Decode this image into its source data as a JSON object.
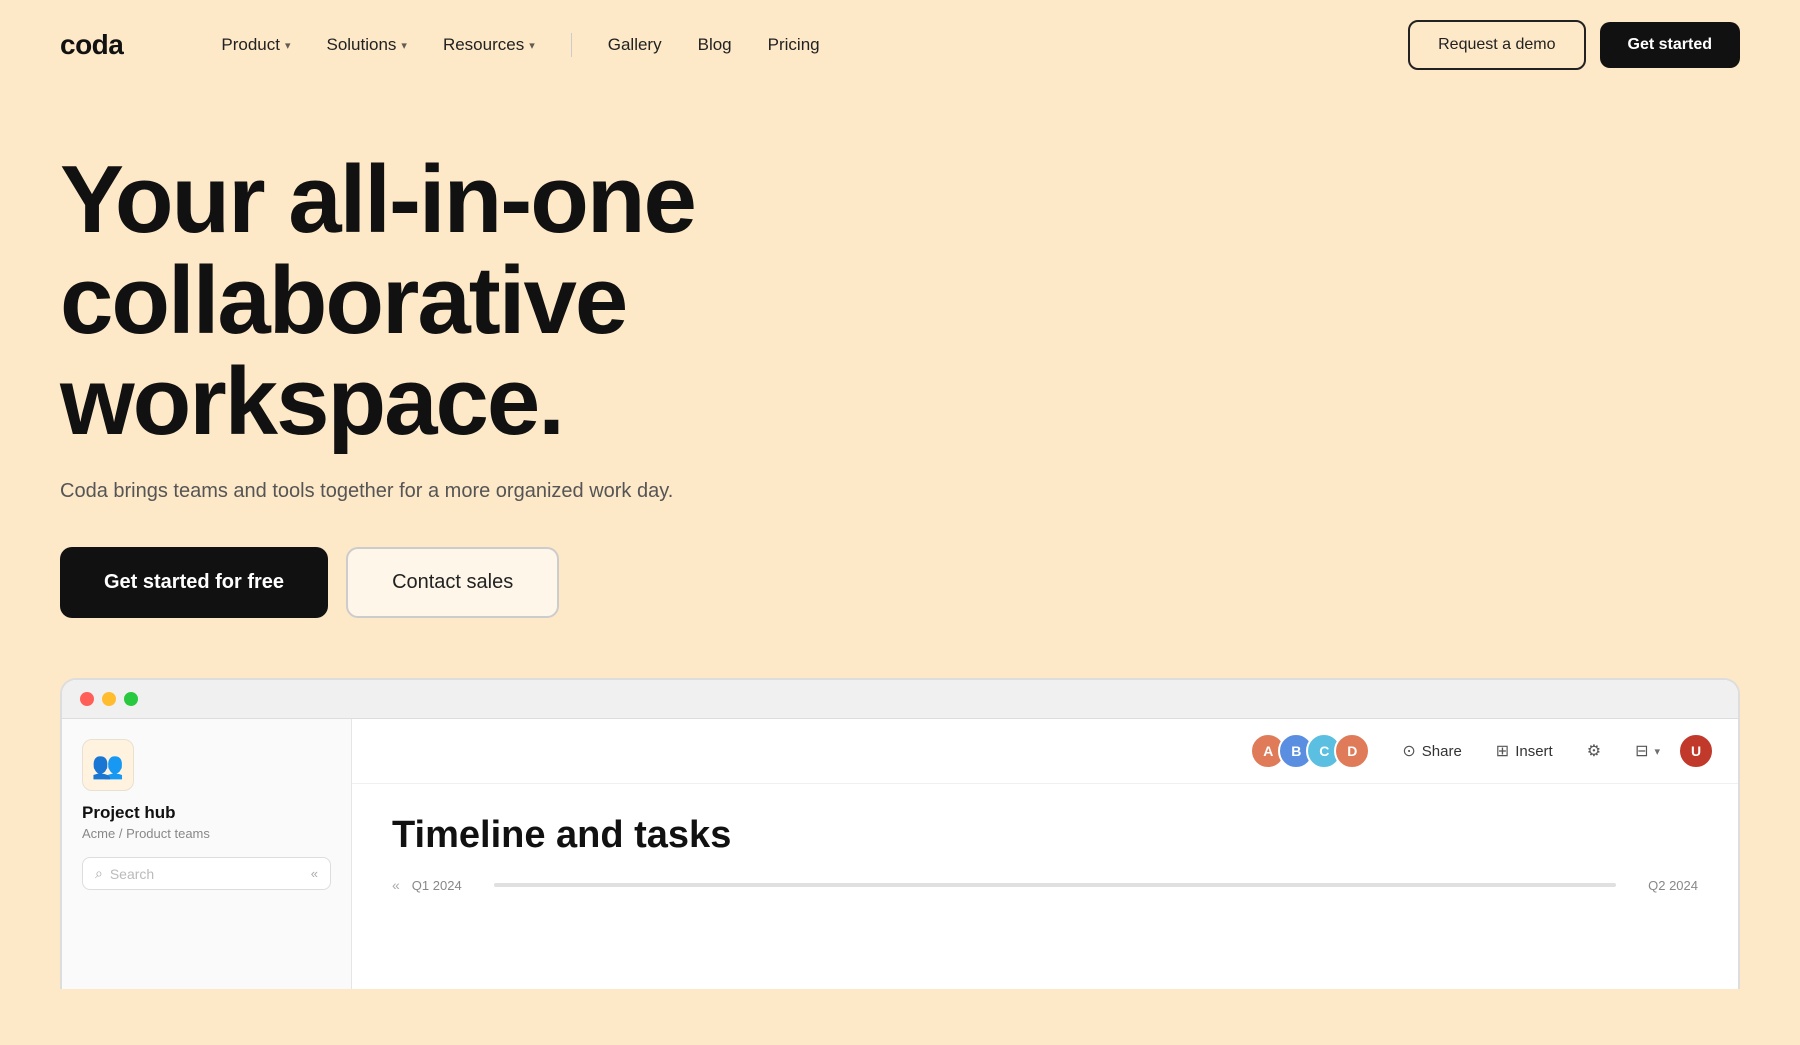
{
  "nav": {
    "logo": "coda",
    "links": [
      {
        "label": "Product",
        "hasDropdown": true
      },
      {
        "label": "Solutions",
        "hasDropdown": true
      },
      {
        "label": "Resources",
        "hasDropdown": true
      },
      {
        "label": "Gallery",
        "hasDropdown": false
      },
      {
        "label": "Blog",
        "hasDropdown": false
      },
      {
        "label": "Pricing",
        "hasDropdown": false
      }
    ],
    "request_demo_label": "Request a demo",
    "get_started_label": "Get started"
  },
  "hero": {
    "title_line1": "Your all-in-one",
    "title_line2": "collaborative workspace.",
    "subtitle": "Coda brings teams and tools together for a more organized work day.",
    "cta_primary": "Get started for free",
    "cta_secondary": "Contact sales"
  },
  "app_window": {
    "sidebar": {
      "workspace_emoji": "👥",
      "workspace_title": "Project hub",
      "workspace_sub": "Acme / Product teams",
      "search_placeholder": "Search"
    },
    "toolbar": {
      "avatars": [
        {
          "id": "av1",
          "initial": "A"
        },
        {
          "id": "av2",
          "initial": "B"
        },
        {
          "id": "av3",
          "initial": "C"
        },
        {
          "id": "av4",
          "initial": "D"
        }
      ],
      "share_label": "Share",
      "insert_label": "Insert",
      "user_initial": "U"
    },
    "content": {
      "doc_title": "Timeline and tasks",
      "timeline_q1": "Q1 2024",
      "timeline_q2": "Q2 2024"
    }
  }
}
